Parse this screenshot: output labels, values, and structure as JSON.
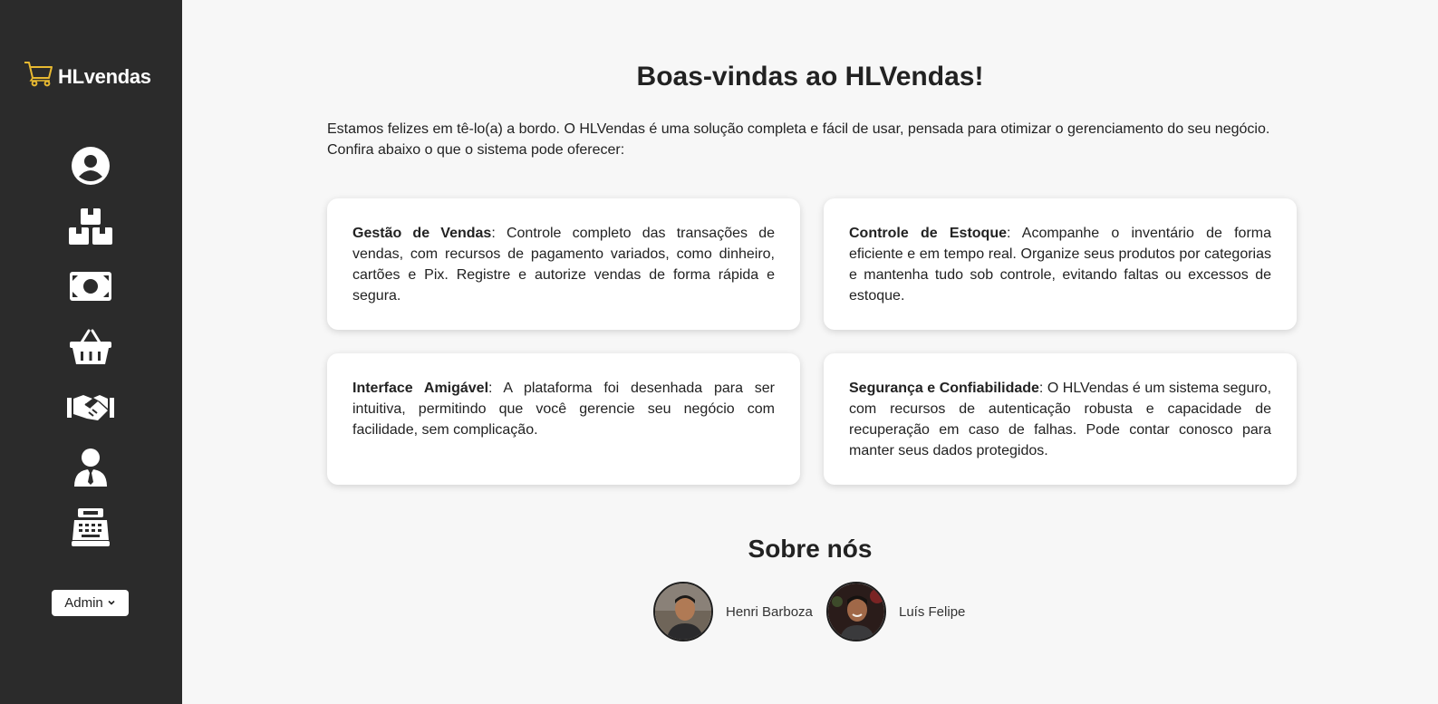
{
  "brand": {
    "name": "HLvendas",
    "icon": "shopping-cart-icon",
    "accent": "#e8b931"
  },
  "sidebar": {
    "nav": [
      {
        "icon": "user-circle-icon"
      },
      {
        "icon": "boxes-icon"
      },
      {
        "icon": "money-bill-icon"
      },
      {
        "icon": "basket-icon"
      },
      {
        "icon": "handshake-icon"
      },
      {
        "icon": "user-tie-icon"
      },
      {
        "icon": "cash-register-icon"
      }
    ],
    "admin_label": "Admin"
  },
  "main": {
    "title": "Boas-vindas ao HLVendas!",
    "intro": "Estamos felizes em tê-lo(a) a bordo. O HLVendas é uma solução completa e fácil de usar, pensada para otimizar o gerenciamento do seu negócio. Confira abaixo o que o sistema pode oferecer:",
    "cards": [
      {
        "heading": "Gestão de Vendas",
        "text": ": Controle completo das transações de vendas, com recursos de pagamento variados, como dinheiro, cartões e Pix. Registre e autorize vendas de forma rápida e segura."
      },
      {
        "heading": "Controle de Estoque",
        "text": ": Acompanhe o inventário de forma eficiente e em tempo real. Organize seus produtos por categorias e mantenha tudo sob controle, evitando faltas ou excessos de estoque."
      },
      {
        "heading": "Interface Amigável",
        "text": ": A plataforma foi desenhada para ser intuitiva, permitindo que você gerencie seu negócio com facilidade, sem complicação."
      },
      {
        "heading": "Segurança e Confiabilidade",
        "text": ": O HLVendas é um sistema seguro, com recursos de autenticação robusta e capacidade de recuperação em caso de falhas. Pode contar conosco para manter seus dados protegidos."
      }
    ],
    "about_title": "Sobre nós",
    "members": [
      {
        "name": "Henri Barboza"
      },
      {
        "name": "Luís Felipe"
      }
    ]
  }
}
